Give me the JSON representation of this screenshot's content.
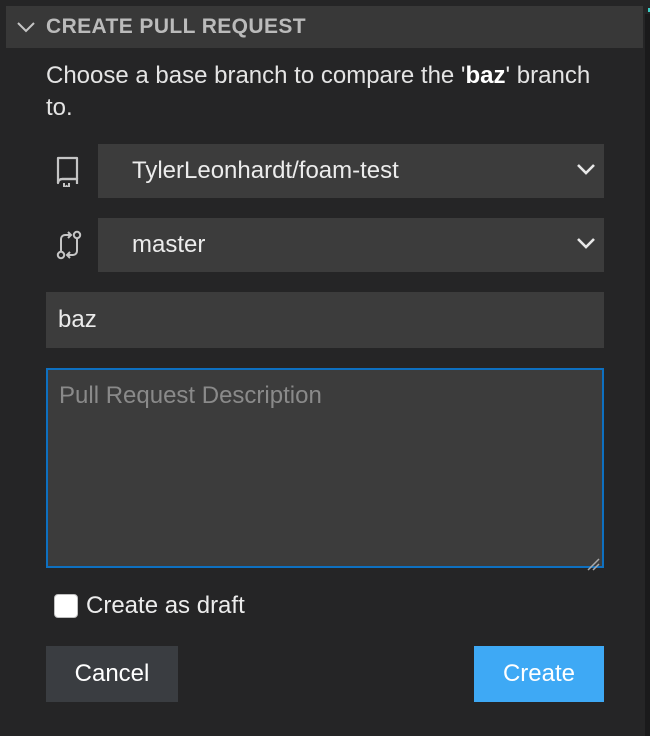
{
  "header": {
    "title": "CREATE PULL REQUEST",
    "chevron_icon": "chevron-down-icon"
  },
  "intro": {
    "prefix": "Choose a base branch to compare the '",
    "branch": "baz",
    "suffix": "' branch to."
  },
  "repo_select": {
    "icon": "repo-icon",
    "value": "TylerLeonhardt/foam-test"
  },
  "branch_select": {
    "icon": "git-compare-icon",
    "value": "master"
  },
  "title_input": {
    "value": "baz"
  },
  "description": {
    "placeholder": "Pull Request Description",
    "value": ""
  },
  "draft": {
    "label": "Create as draft",
    "checked": false
  },
  "buttons": {
    "cancel": "Cancel",
    "create": "Create"
  },
  "colors": {
    "background": "#252526",
    "header": "#383838",
    "input": "#3c3c3c",
    "focus_border": "#0e70c0",
    "primary_button": "#3ea9f5",
    "secondary_button": "#3a3d41",
    "accent": "#3ad0c8"
  }
}
